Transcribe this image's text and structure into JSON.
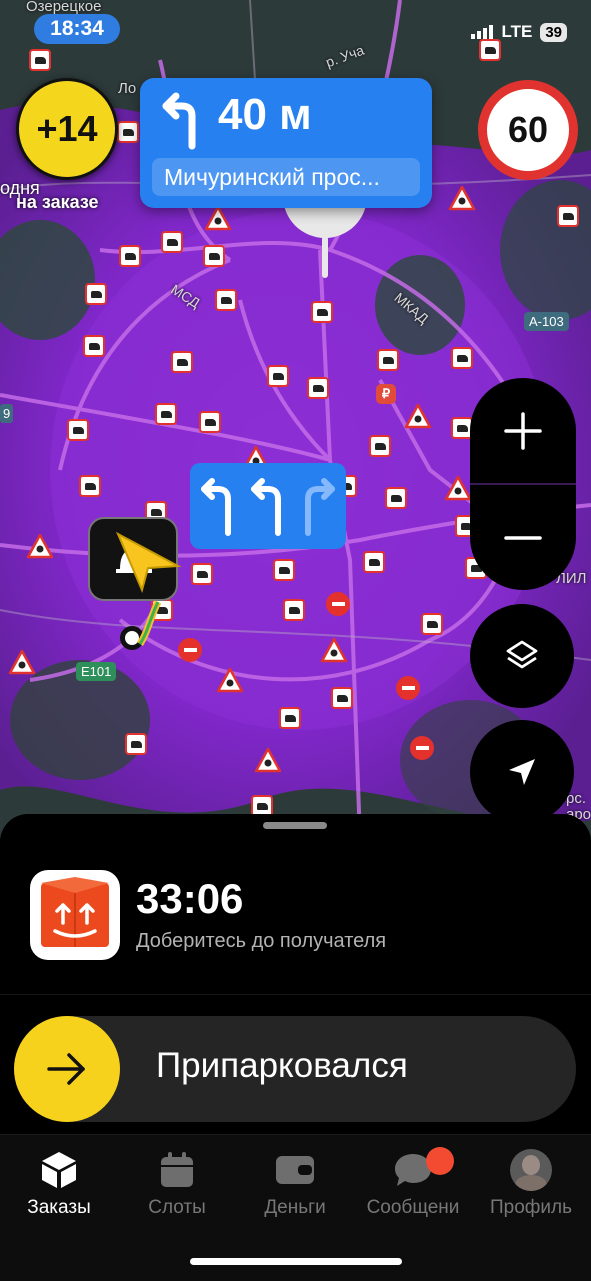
{
  "status_bar": {
    "time": "18:34",
    "network": "LTE",
    "battery": "39"
  },
  "map": {
    "place_labels": [
      "Озерецкое",
      "Ло",
      "одня",
      "р. Уча",
      "МСД",
      "МКАД",
      "А-103",
      "Е101",
      "9",
      "ЛИЛ",
      "рс.",
      "аро"
    ],
    "accent_color": "#9b2bd9",
    "road_color": "#c66be8"
  },
  "bonus": {
    "value": "+14",
    "label": "на заказе"
  },
  "navigation": {
    "distance": "40 м",
    "street": "Мичуринский прос...",
    "turn_icon": "turn-left-arrow-icon"
  },
  "speed_limit": {
    "value": "60"
  },
  "map_controls": {
    "zoom_in_icon": "plus-icon",
    "zoom_out_icon": "minus-icon",
    "layers_icon": "layers-icon",
    "locate_icon": "navigation-arrow-icon"
  },
  "delivery": {
    "timer": "33:06",
    "subtitle": "Доберитесь до получателя"
  },
  "action": {
    "label": "Припарковался"
  },
  "tabs": [
    {
      "label": "Заказы",
      "icon": "box-icon",
      "active": true
    },
    {
      "label": "Слоты",
      "icon": "calendar-icon",
      "active": false
    },
    {
      "label": "Деньги",
      "icon": "wallet-icon",
      "active": false
    },
    {
      "label": "Сообщени",
      "icon": "chat-icon",
      "active": false
    },
    {
      "label": "Профиль",
      "icon": "avatar-icon",
      "active": false
    }
  ]
}
